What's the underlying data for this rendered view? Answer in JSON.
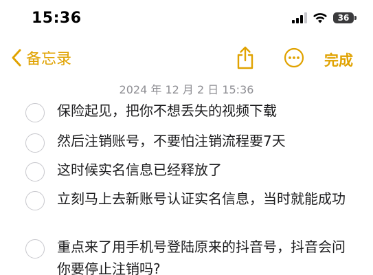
{
  "status_bar": {
    "time": "15:36",
    "battery_level": "36",
    "signal_icon": "cellular-signal-icon",
    "wifi_icon": "wifi-icon",
    "battery_icon": "battery-icon"
  },
  "nav": {
    "back_label": "备忘录",
    "done_label": "完成",
    "share_icon": "share-icon",
    "more_icon": "more-icon",
    "accent_color": "#e0a200"
  },
  "note": {
    "date": "2024 年 12 月 2 日 15:36",
    "items": [
      {
        "text": "保险起见，把你不想丢失的视频下载",
        "checked": false
      },
      {
        "text": "然后注销账号，不要怕注销流程要7天",
        "checked": false
      },
      {
        "text": "这时候实名信息已经释放了",
        "checked": false
      },
      {
        "text": "立刻马上去新账号认证实名信息，当时就能成功",
        "checked": false
      },
      {
        "text": "重点来了用手机号登陆原来的抖音号，抖音会问你要停止注销吗?",
        "checked": false
      }
    ]
  }
}
